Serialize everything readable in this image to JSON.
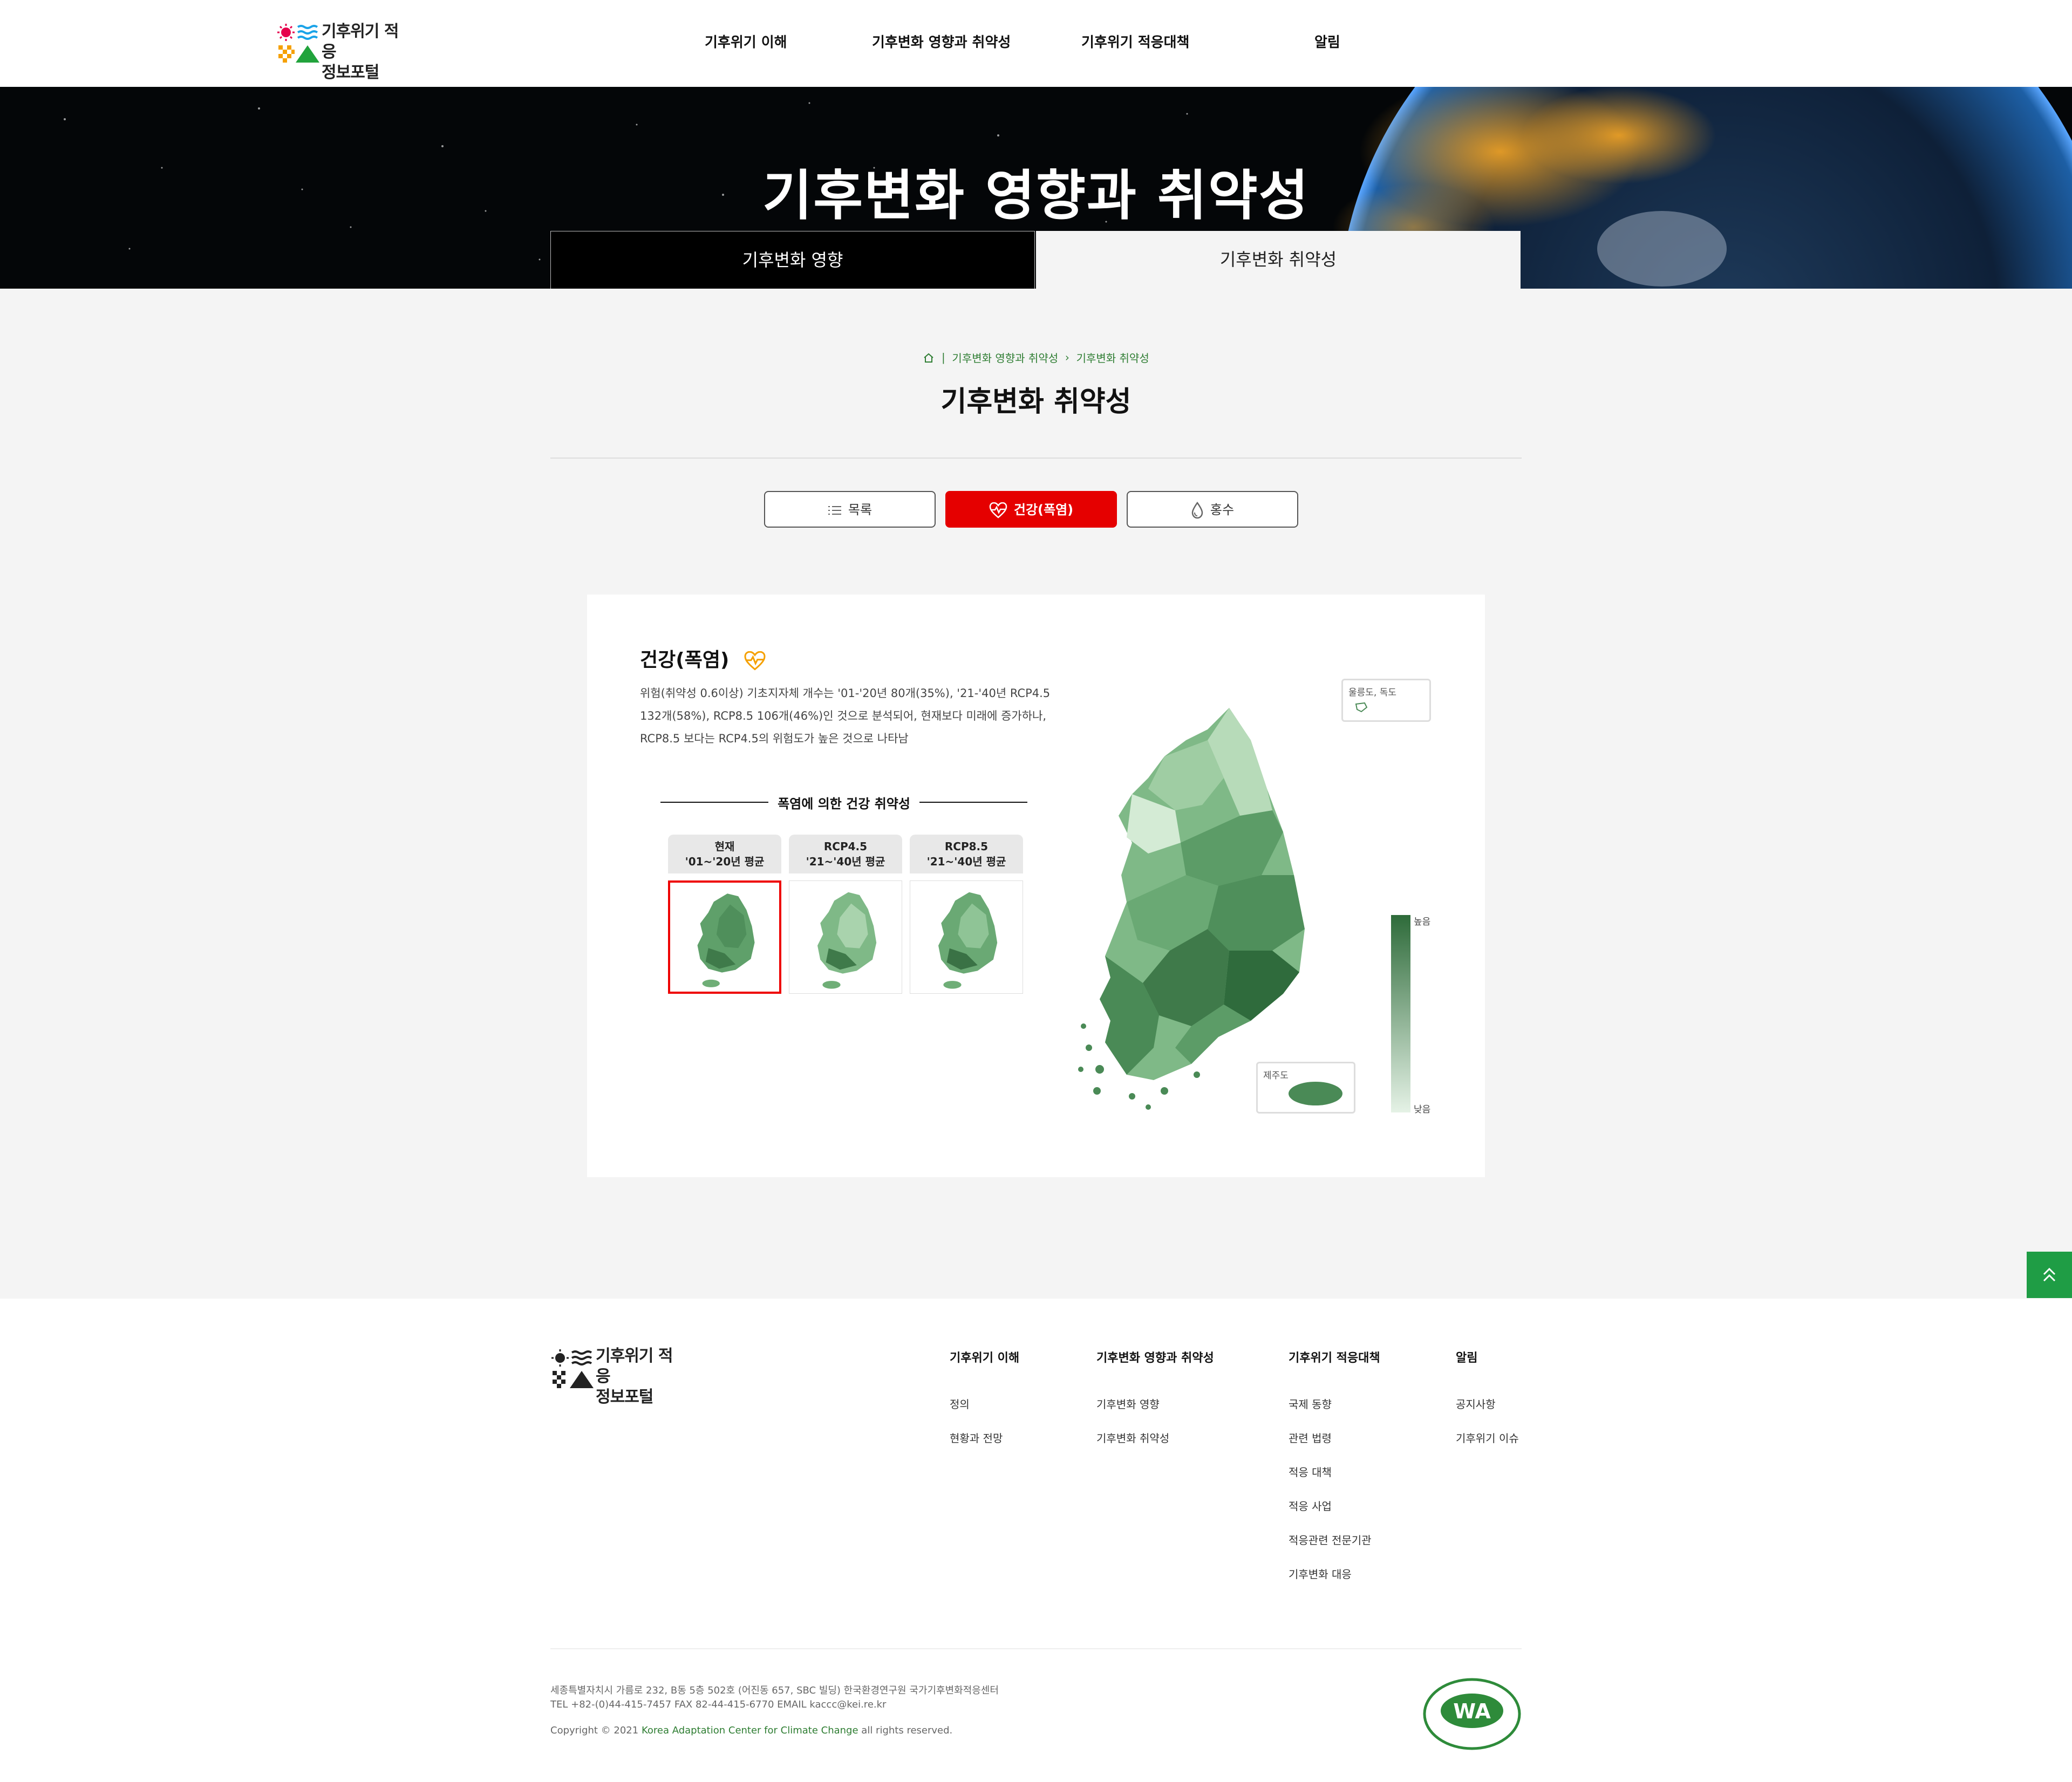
{
  "header": {
    "logo_line1": "기후위기 적응",
    "logo_line2": "정보포털",
    "nav": [
      "기후위기 이해",
      "기후변화 영향과 취약성",
      "기후위기 적응대책",
      "알림"
    ]
  },
  "hero": {
    "title": "기후변화 영향과 취약성",
    "tabs": [
      "기후변화 영향",
      "기후변화 취약성"
    ],
    "active_tab": "기후변화 취약성"
  },
  "breadcrumb": [
    "기후변화 영향과 취약성",
    "기후변화 취약성"
  ],
  "page_title": "기후변화 취약성",
  "categories": [
    {
      "label": "목록",
      "icon": "list-icon"
    },
    {
      "label": "건강(폭염)",
      "icon": "heart-pulse-icon",
      "active": true
    },
    {
      "label": "홍수",
      "icon": "water-drop-icon"
    }
  ],
  "card": {
    "title": "건강(폭염)",
    "description": "위험(취약성 0.6이상) 기초지자체 개수는 '01-'20년 80개(35%), '21-'40년 RCP4.5 132개(58%), RCP8.5 106개(46%)인 것으로 분석되어, 현재보다 미래에 증가하나, RCP8.5 보다는 RCP4.5의 위험도가 높은 것으로 나타남",
    "chart_title": "폭염에 의한 건강 취약성",
    "scenarios": [
      {
        "line1": "현재",
        "line2": "'01~'20년 평균",
        "selected": true
      },
      {
        "line1": "RCP4.5",
        "line2": "'21~'40년 평균",
        "selected": false
      },
      {
        "line1": "RCP8.5",
        "line2": "'21~'40년 평균",
        "selected": false
      }
    ],
    "inset_ulleung": "울릉도, 독도",
    "inset_jeju": "제주도",
    "legend_high": "높음",
    "legend_low": "낮음",
    "colors": {
      "high": "#2e6b3a",
      "low": "#e5f2e6"
    }
  },
  "footer": {
    "logo_line1": "기후위기 적응",
    "logo_line2": "정보포털",
    "columns": [
      {
        "title": "기후위기 이해",
        "links": [
          "정의",
          "현황과 전망"
        ]
      },
      {
        "title": "기후변화 영향과 취약성",
        "links": [
          "기후변화 영향",
          "기후변화 취약성"
        ]
      },
      {
        "title": "기후위기 적응대책",
        "links": [
          "국제 동향",
          "관련 법령",
          "적응 대책",
          "적응 사업",
          "적응관련 전문기관",
          "기후변화 대응"
        ]
      },
      {
        "title": "알림",
        "links": [
          "공지사항",
          "기후위기 이슈"
        ]
      }
    ],
    "address": "세종특별자치시 가름로 232, B동 5층 502호 (어진동 657, SBC 빌딩) 한국환경연구원 국가기후변화적응센터",
    "contact": "TEL +82-(0)44-415-7457 FAX 82-44-415-6770 EMAIL kaccc@kei.re.kr",
    "copyright_prefix": "Copyright © 2021",
    "copyright_org": "Korea Adaptation Center for Climate Change",
    "copyright_suffix": "all rights reserved.",
    "wa_mark": "WA"
  },
  "accent_color": "#e50000",
  "brand_green": "#1f9d45"
}
